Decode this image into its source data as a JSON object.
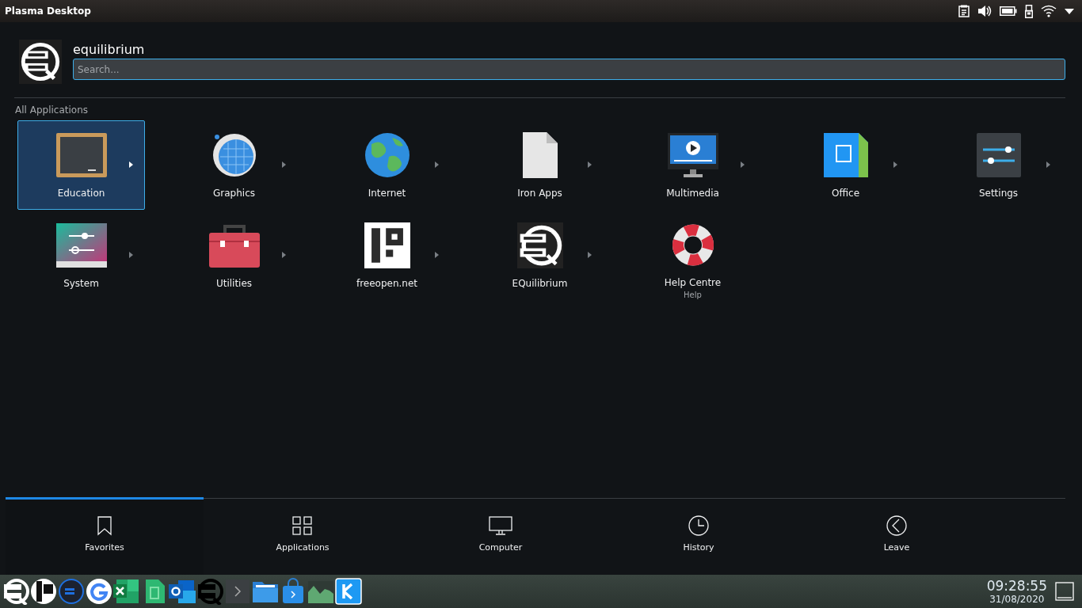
{
  "top_bar": {
    "title": "Plasma Desktop"
  },
  "user": {
    "name": "equilibrium"
  },
  "search": {
    "placeholder": "Search..."
  },
  "section_title": "All Applications",
  "apps": [
    {
      "label": "Education",
      "kind": "chalkboard",
      "selected": true,
      "has_submenu": true
    },
    {
      "label": "Graphics",
      "kind": "sphere",
      "selected": false,
      "has_submenu": true
    },
    {
      "label": "Internet",
      "kind": "globe",
      "selected": false,
      "has_submenu": true
    },
    {
      "label": "Iron Apps",
      "kind": "document",
      "selected": false,
      "has_submenu": true
    },
    {
      "label": "Multimedia",
      "kind": "monitor",
      "selected": false,
      "has_submenu": true
    },
    {
      "label": "Office",
      "kind": "office",
      "selected": false,
      "has_submenu": true
    },
    {
      "label": "Settings",
      "kind": "sliders",
      "selected": false,
      "has_submenu": true
    },
    {
      "label": "System",
      "kind": "system",
      "selected": false,
      "has_submenu": true
    },
    {
      "label": "Utilities",
      "kind": "toolbox",
      "selected": false,
      "has_submenu": true
    },
    {
      "label": "freeopen.net",
      "kind": "freeopen",
      "selected": false,
      "has_submenu": true
    },
    {
      "label": "EQuilibrium",
      "kind": "equilibrium",
      "selected": false,
      "has_submenu": true
    },
    {
      "label": "Help Centre",
      "subtitle": "Help",
      "kind": "lifebuoy",
      "selected": false,
      "has_submenu": false
    }
  ],
  "tabs": [
    {
      "label": "Favorites",
      "kind": "bookmark",
      "selected": true
    },
    {
      "label": "Applications",
      "kind": "grid",
      "selected": false
    },
    {
      "label": "Computer",
      "kind": "computer",
      "selected": false
    },
    {
      "label": "History",
      "kind": "clock",
      "selected": false
    },
    {
      "label": "Leave",
      "kind": "leave",
      "selected": false
    }
  ],
  "clock": {
    "time": "09:28:55",
    "date": "31/08/2020"
  }
}
